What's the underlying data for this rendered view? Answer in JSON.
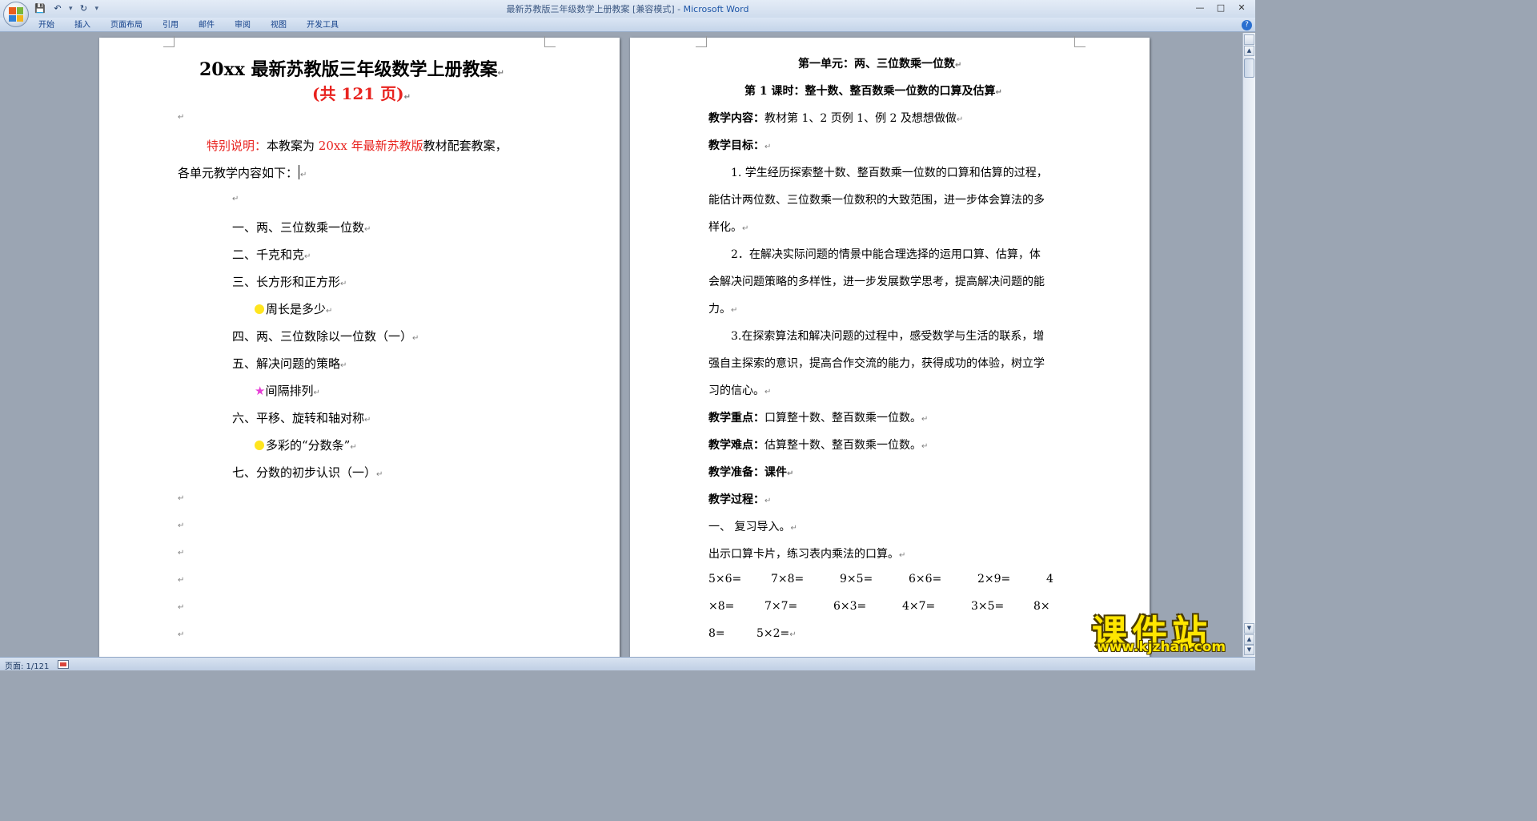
{
  "window": {
    "title": "最新苏教版三年级数学上册教案 [兼容模式] - ",
    "app": "Microsoft Word"
  },
  "qat": {
    "save": "💾",
    "undo": "↶",
    "redo": "↻",
    "more": "▾"
  },
  "window_controls": {
    "minimize": "—",
    "maximize": "□",
    "close": "✕"
  },
  "ribbon": {
    "tabs": [
      "开始",
      "插入",
      "页面布局",
      "引用",
      "邮件",
      "审阅",
      "视图",
      "开发工具"
    ],
    "help": "?"
  },
  "paragraph_mark": "↵",
  "left_page": {
    "title": "20xx 最新苏教版三年级数学上册教案",
    "subtitle": "(共 121 页)",
    "note_label": "特别说明：",
    "note_text1": "本教案为 ",
    "note_red": "20xx 年最新苏教版",
    "note_text2": "教材配套教案，",
    "note_line2": "各单元教学内容如下：",
    "units": [
      "一、两、三位数乘一位数",
      "二、千克和克",
      "三、长方形和正方形",
      "周长是多少",
      "四、两、三位数除以一位数（一）",
      "五、解决问题的策略",
      "间隔排列",
      "六、平移、旋转和轴对称",
      "多彩的“分数条”",
      "七、分数的初步认识（一）"
    ],
    "star_glyph": "★"
  },
  "right_page": {
    "unit_title": "第一单元：两、三位数乘一位数",
    "lesson_title": "第 1 课时：整十数、整百数乘一位数的口算及估算",
    "content_label": "教学内容：",
    "content_text": "教材第 1、2 页例 1、例 2 及想想做做",
    "goals_label": "教学目标：",
    "goal1_l1": "1. 学生经历探索整十数、整百数乘一位数的口算和估算的过程，",
    "goal1_l2": "能估计两位数、三位数乘一位数积的大致范围，进一步体会算法的多",
    "goal1_l3": "样化。",
    "goal2_l1": "2．在解决实际问题的情景中能合理选择的运用口算、估算，体",
    "goal2_l2": "会解决问题策略的多样性，进一步发展数学思考，提高解决问题的能",
    "goal2_l3": "力。",
    "goal3_l1": "3.在探索算法和解决问题的过程中，感受数学与生活的联系，增",
    "goal3_l2": "强自主探索的意识，提高合作交流的能力，获得成功的体验，树立学",
    "goal3_l3": "习的信心。",
    "key_label": "教学重点：",
    "key_text": "口算整十数、整百数乘一位数。",
    "diff_label": "教学难点：",
    "diff_text": "估算整十数、整百数乘一位数。",
    "prep_label": "教学准备：",
    "prep_text": "课件",
    "process_label": "教学过程：",
    "step1": "一、    复习导入。",
    "step1_text": "出示口算卡片，练习表内乘法的口算。",
    "calc_row1": [
      "5×6=",
      "7×8=",
      "9×5=",
      "6×6=",
      "2×9=",
      "4"
    ],
    "calc_row2": [
      "×8=",
      "7×7=",
      "6×3=",
      "4×7=",
      "3×5=",
      "8×"
    ],
    "calc_row3": [
      "8=",
      "5×2="
    ]
  },
  "status": {
    "page": "页面: 1/121"
  },
  "watermark": {
    "main": "课件站",
    "url": "www.kjzhan.com"
  }
}
